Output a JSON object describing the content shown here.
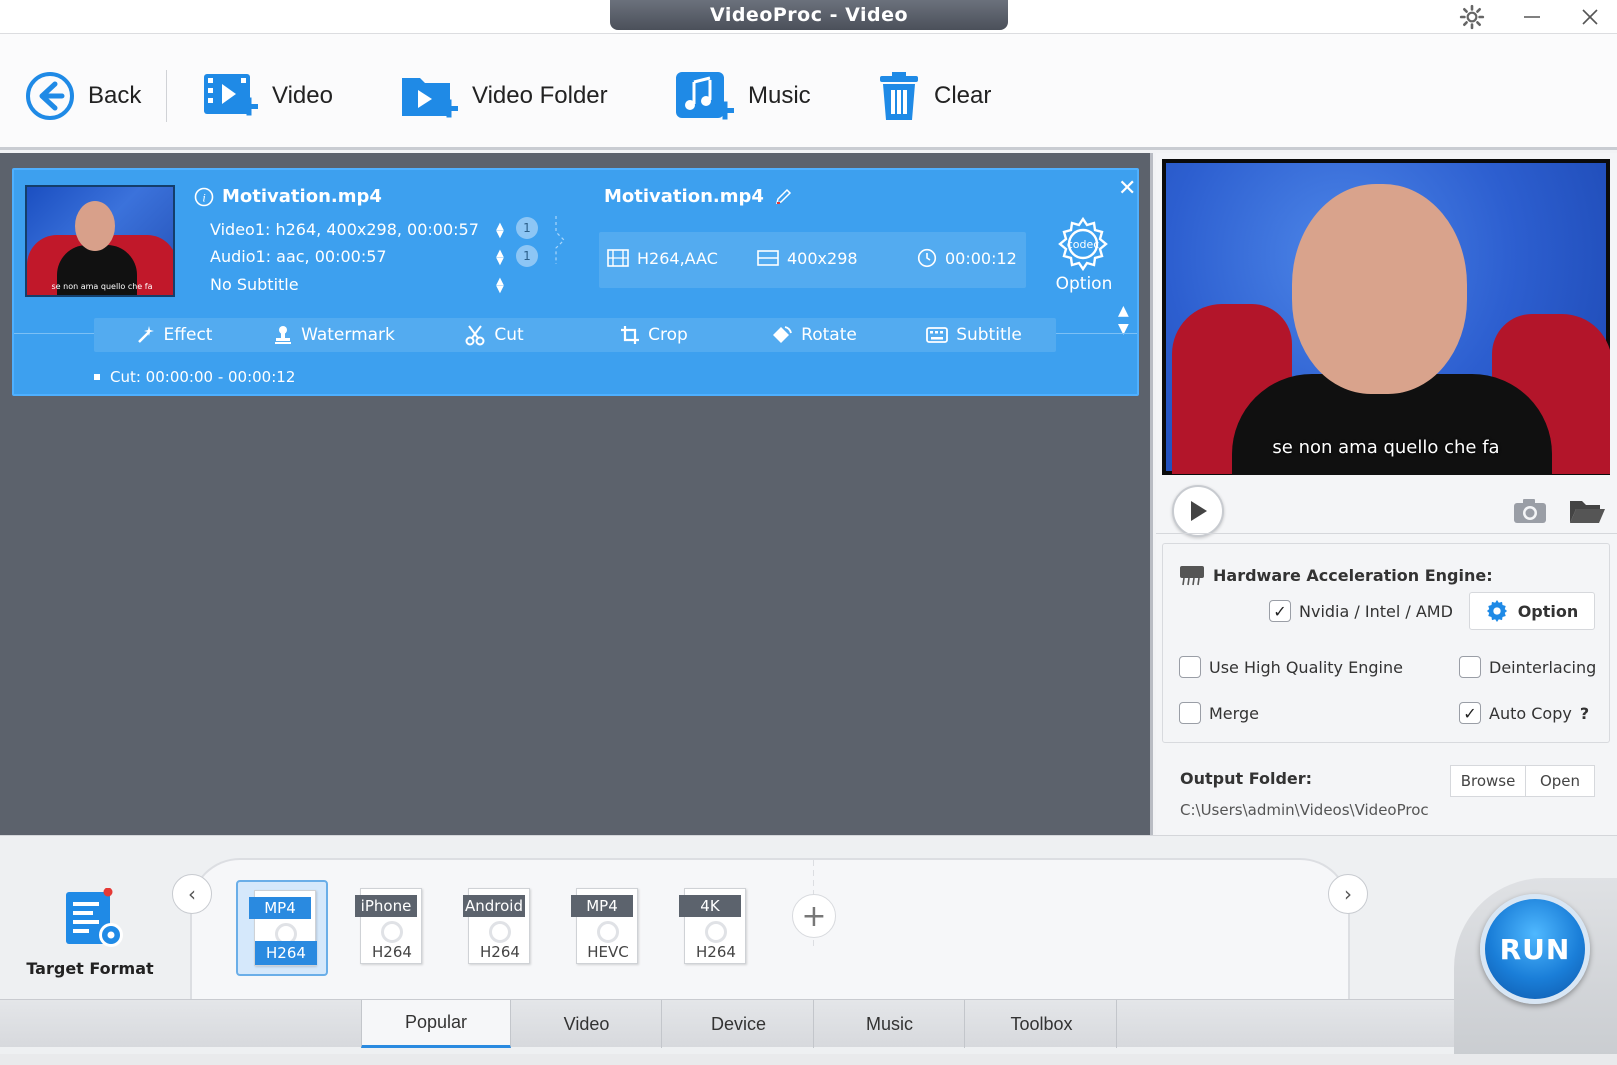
{
  "window": {
    "title": "VideoProc - Video"
  },
  "toolbar": {
    "back": "Back",
    "video": "Video",
    "video_folder": "Video Folder",
    "music": "Music",
    "clear": "Clear"
  },
  "item": {
    "source_name": "Motivation.mp4",
    "video_track": "Video1: h264, 400x298, 00:00:57",
    "audio_track": "Audio1: aac, 00:00:57",
    "subtitle_track": "No Subtitle",
    "video_count": "1",
    "audio_count": "1",
    "output_name": "Motivation.mp4",
    "codec": "H264,AAC",
    "resolution": "400x298",
    "duration": "00:00:12",
    "option_label": "Option",
    "codec_badge": "codec",
    "thumb_caption": "se non ama quello che fa",
    "edit": {
      "effect": "Effect",
      "watermark": "Watermark",
      "cut": "Cut",
      "crop": "Crop",
      "rotate": "Rotate",
      "subtitle": "Subtitle"
    },
    "cut_info": "Cut: 00:00:00 - 00:00:12"
  },
  "preview": {
    "caption": "se non ama quello che fa"
  },
  "hardware": {
    "title": "Hardware Acceleration Engine:",
    "nvidia": "Nvidia / Intel / AMD",
    "option_btn": "Option",
    "high_quality": "Use High Quality Engine",
    "deinterlacing": "Deinterlacing",
    "merge": "Merge",
    "auto_copy": "Auto Copy",
    "help": "?"
  },
  "output": {
    "label": "Output Folder:",
    "path": "C:\\Users\\admin\\Videos\\VideoProc",
    "browse": "Browse",
    "open": "Open"
  },
  "target_format": {
    "label": "Target Format",
    "formats": [
      {
        "top": "MP4",
        "bottom": "H264"
      },
      {
        "top": "iPhone",
        "bottom": "H264"
      },
      {
        "top": "Android",
        "bottom": "H264"
      },
      {
        "top": "MP4",
        "bottom": "HEVC"
      },
      {
        "top": "4K",
        "bottom": "H264"
      }
    ],
    "add": "+"
  },
  "tabs": [
    "Popular",
    "Video",
    "Device",
    "Music",
    "Toolbox"
  ],
  "run": "RUN",
  "colors": {
    "accent": "#2a8ae0",
    "card": "#3da0ef"
  }
}
